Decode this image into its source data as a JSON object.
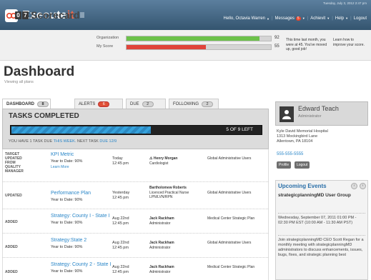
{
  "app": {
    "name_part1": "Execute",
    "name_part2": "it"
  },
  "topbar": {
    "date": "Tuesday, July 3, 2012 2:47 pm",
    "greeting": "Hello, Octavia Warren",
    "messages_label": "Messages",
    "messages_count": "5",
    "achievit_label": "Achievit",
    "help_label": "Help",
    "logout_label": "Logout"
  },
  "scorecard": {
    "digits": [
      "0",
      "7"
    ],
    "title": "Scorecard",
    "org_label": "Organization",
    "my_label": "My Score",
    "org_value": 92,
    "my_value": 55,
    "msg_left": "This time last month, you were at 45. You've moved up, good job!",
    "msg_right": "Learn how to improve your score.",
    "colors": {
      "org_bar": "#6cc24a",
      "my_bar": "#e0443b"
    }
  },
  "page": {
    "title": "Dashboard",
    "subtitle": "Viewing all plans"
  },
  "tabs": [
    {
      "label": "DASHBOARD",
      "count": "8",
      "active": true
    },
    {
      "label": "ALERTS",
      "count": "6",
      "alert": true
    },
    {
      "label": "DUE",
      "count": "2"
    },
    {
      "label": "FOLLOWING",
      "count": "2"
    }
  ],
  "tasks": {
    "title": "TASKS COMPLETED",
    "completed": 5,
    "total": 9,
    "progress_text": "5 OF 9 LEFT",
    "note_prefix": "YOU HAVE 1 TASK DUE",
    "note_link1": "THIS WEEK.",
    "note_mid": "NEXT TASK",
    "note_link2": "DUE 12/9"
  },
  "rows": [
    {
      "status": "TARGET UPDATED FROM QUALITY MANAGER",
      "title": "KPI Metric",
      "ytd": "Year to Date: 90%",
      "learn": "Learn More",
      "due1": "Today",
      "due2": "12:45 pm",
      "person": "Henry Morgan",
      "role": "Cardiologist",
      "org": "Global Administrative Users"
    },
    {
      "status": "UPDATED",
      "title": "Performance Plan",
      "ytd": "Year to Date: 90%",
      "learn": "",
      "due1": "Yesterday",
      "due2": "12:45 pm",
      "person": "Bartholomew Roberts",
      "role": "Licenced Practical Nurse LPN/LVN/RPN",
      "org": "Global Administrative Users"
    },
    {
      "status": "ADDED",
      "title": "Strategy: County I - State I",
      "ytd": "Year to Date: 90%",
      "learn": "",
      "due1": "Aug 22nd",
      "due2": "12:45 pm",
      "person": "Jack Rackham",
      "role": "Administrator",
      "org": "Medical Center Strategic Plan"
    },
    {
      "status": "ADDED",
      "title": "Strategy:State 2",
      "ytd": "Year to Date: 90%",
      "learn": "",
      "due1": "Aug 22nd",
      "due2": "12:45 pm",
      "person": "Jack Rackham",
      "role": "Administrator",
      "org": "Global Administrative Users"
    },
    {
      "status": "ADDED",
      "title": "Strategy: County 2 - State I",
      "ytd": "Year to Date: 90%",
      "learn": "",
      "due1": "Aug 22nd",
      "due2": "12:45 pm",
      "person": "Jack Rackham",
      "role": "Administrator",
      "org": "Medical Center Strategic Plan"
    }
  ],
  "profile": {
    "name": "Edward Teach",
    "role": "Administrator",
    "address": [
      "Kyle David Memorial Hospital",
      "1313 Mockingbird Lane",
      "Allentown, PA 18104"
    ],
    "phone": "555-555-5555",
    "btn_profile": "Profile",
    "btn_logout": "Logout"
  },
  "events": {
    "heading": "Upcoming Events",
    "title": "strategicplanningMD User Group",
    "when": "Wednesday, September 07, 2011 01:00 PM - 02:30 PM EST (10:00 AM - 11:30 AM PST)",
    "desc": "Join strategicplanningMD CEO Scott Regan for a monthly meeting with strategicplanningMD administrators to discuss enhancements, issues, bugs, fixes, and strategic planning best"
  }
}
